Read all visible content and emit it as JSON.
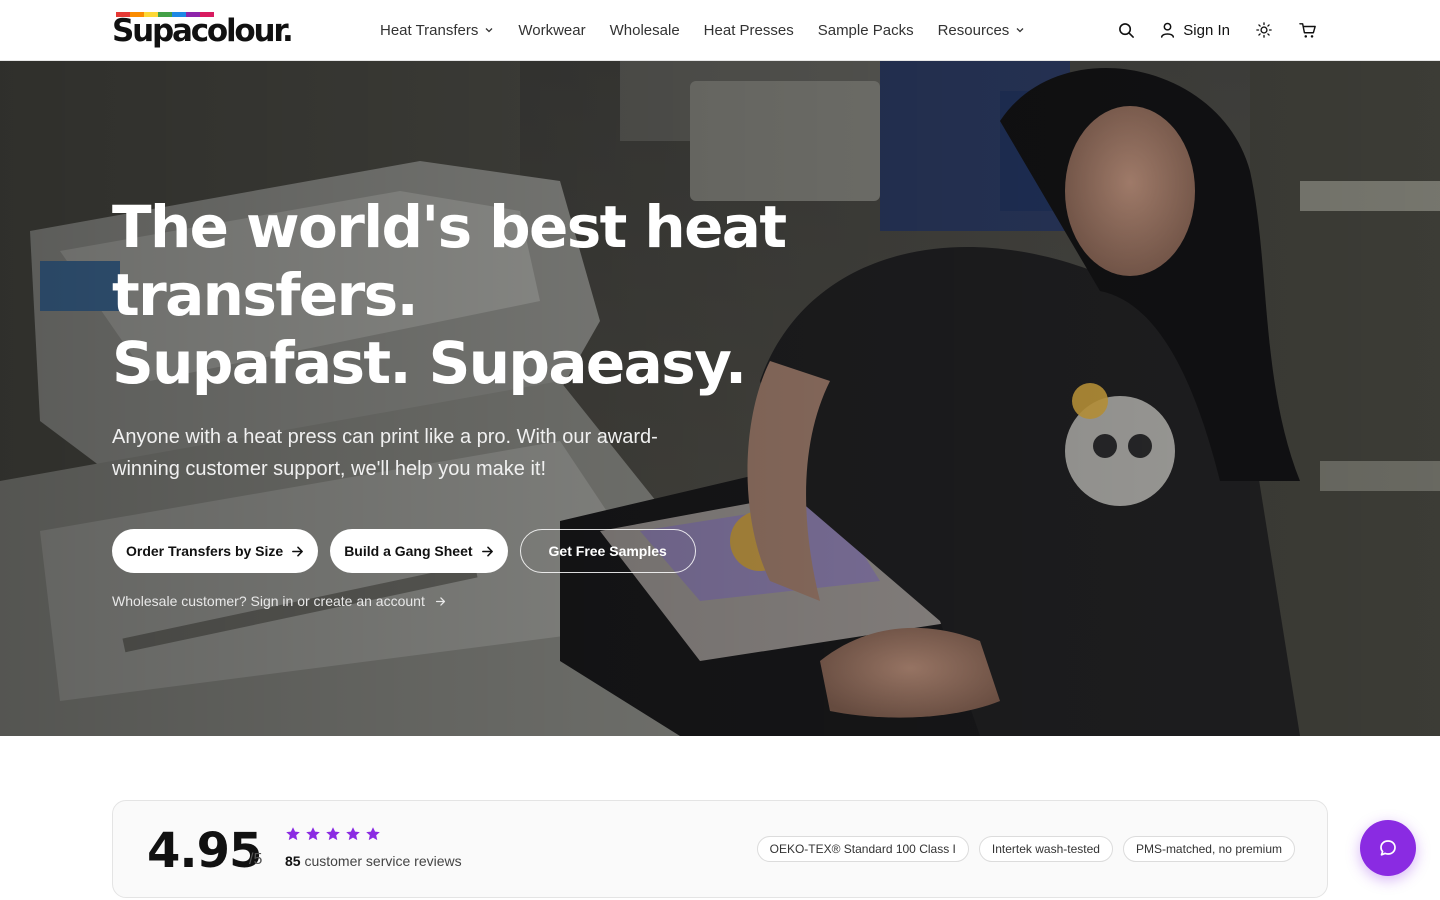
{
  "brand": {
    "name": "Supacolour.",
    "logo_colors": [
      "#e53935",
      "#fb8c00",
      "#fdd835",
      "#43a047",
      "#1e88e5",
      "#8e24aa",
      "#d81b60"
    ]
  },
  "nav": {
    "items": [
      {
        "label": "Heat Transfers",
        "has_dropdown": true
      },
      {
        "label": "Workwear",
        "has_dropdown": false
      },
      {
        "label": "Wholesale",
        "has_dropdown": false
      },
      {
        "label": "Heat Presses",
        "has_dropdown": false
      },
      {
        "label": "Sample Packs",
        "has_dropdown": false
      },
      {
        "label": "Resources",
        "has_dropdown": true
      }
    ]
  },
  "header_actions": {
    "search_icon": "search-icon",
    "signin_label": "Sign In",
    "theme_icon": "sun-icon",
    "cart_icon": "cart-icon"
  },
  "hero": {
    "title_line1": "The world's best heat",
    "title_line2": "transfers.",
    "title_line3": "Supafast. Supaeasy.",
    "subtitle": "Anyone with a heat press can print like a pro. With our award-winning customer support, we'll help you make it!",
    "buttons": {
      "order_by_size": "Order Transfers by Size",
      "gang_sheet": "Build a Gang Sheet",
      "free_samples": "Get Free Samples"
    },
    "wholesale_link": "Wholesale customer? Sign in or create an account"
  },
  "reviews": {
    "score": "4.95",
    "out_of": "/5",
    "stars": 5,
    "count": "85",
    "count_label": "customer service reviews",
    "star_color": "#8a2be2",
    "badges": [
      "OEKO-TEX® Standard 100 Class I",
      "Intertek wash-tested",
      "PMS-matched, no premium"
    ]
  },
  "chat": {
    "icon": "chat-bubble-icon",
    "color": "#8a2be2"
  }
}
